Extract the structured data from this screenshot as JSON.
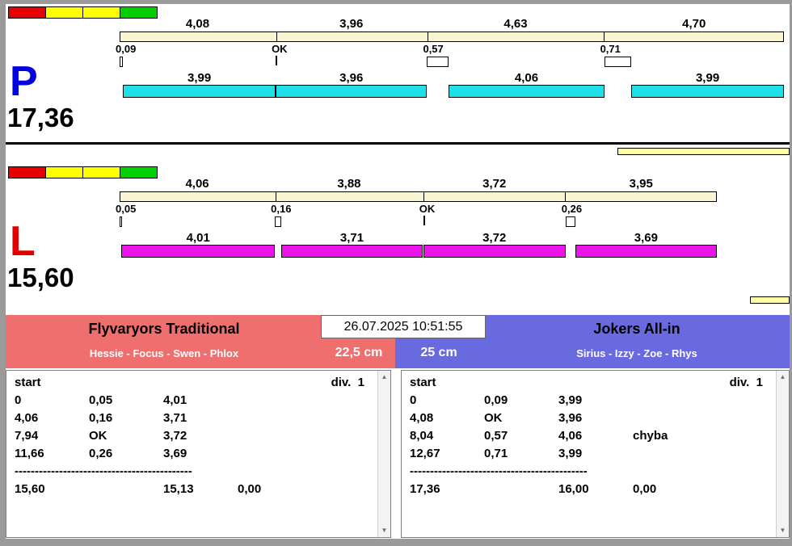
{
  "window": {
    "datetime": "26.07.2025 10:51:55",
    "frame_color": "#9a9a9a",
    "progress_color": "#ffffa8"
  },
  "lanes": [
    {
      "letter": "P",
      "letter_color": "#0000e0",
      "total_label": "17,36",
      "status_lights": [
        "#e80000",
        "#ffff00",
        "#ffff00",
        "#00cf00"
      ],
      "split_color": "#f9f5d2",
      "run_color": "#1fdfe8",
      "splits": [
        {
          "label": "4,08",
          "value": 4.08
        },
        {
          "label": "3,96",
          "value": 3.96
        },
        {
          "label": "4,63",
          "value": 4.63
        },
        {
          "label": "4,70",
          "value": 4.7
        }
      ],
      "changes": [
        {
          "label": "0,09",
          "at": 0,
          "error": 0.09
        },
        {
          "label": "OK",
          "at": 4.08,
          "error": 0
        },
        {
          "label": "0,57",
          "at": 8.04,
          "error": 0.57
        },
        {
          "label": "0,71",
          "at": 12.67,
          "error": 0.71
        }
      ],
      "runs": [
        {
          "label": "3,99",
          "start": 0.09,
          "value": 3.99
        },
        {
          "label": "3,96",
          "start": 4.08,
          "value": 3.96
        },
        {
          "label": "4,06",
          "start": 8.61,
          "value": 4.06
        },
        {
          "label": "3,99",
          "start": 13.38,
          "value": 3.99
        }
      ]
    },
    {
      "letter": "L",
      "letter_color": "#e00000",
      "total_label": "15,60",
      "status_lights": [
        "#e80000",
        "#ffff00",
        "#ffff00",
        "#00cf00"
      ],
      "split_color": "#f9f5d2",
      "run_color": "#ea14ea",
      "splits": [
        {
          "label": "4,06",
          "value": 4.06
        },
        {
          "label": "3,88",
          "value": 3.88
        },
        {
          "label": "3,72",
          "value": 3.72
        },
        {
          "label": "3,95",
          "value": 3.95
        }
      ],
      "changes": [
        {
          "label": "0,05",
          "at": 0,
          "error": 0.05
        },
        {
          "label": "0,16",
          "at": 4.06,
          "error": 0.16
        },
        {
          "label": "OK",
          "at": 7.94,
          "error": 0
        },
        {
          "label": "0,26",
          "at": 11.66,
          "error": 0.26
        }
      ],
      "runs": [
        {
          "label": "4,01",
          "start": 0.05,
          "value": 4.01
        },
        {
          "label": "3,71",
          "start": 4.22,
          "value": 3.71
        },
        {
          "label": "3,72",
          "start": 7.94,
          "value": 3.72
        },
        {
          "label": "3,69",
          "start": 11.92,
          "value": 3.69
        }
      ]
    }
  ],
  "teams": [
    {
      "name": "Flyvaryors Traditional",
      "members": "Hessie - Focus - Swen - Phlox",
      "color": "#ef6e6e",
      "height_label": "22,5 cm",
      "table": {
        "header_left": "start",
        "header_right": "div.  1",
        "rows": [
          [
            "0",
            "0,05",
            "4,01",
            ""
          ],
          [
            "4,06",
            "0,16",
            "3,71",
            ""
          ],
          [
            "7,94",
            "OK",
            "3,72",
            ""
          ],
          [
            "11,66",
            "0,26",
            "3,69",
            ""
          ]
        ],
        "divider": "--------------------------------------------",
        "totals": [
          "15,60",
          "",
          "15,13",
          "0,00"
        ]
      }
    },
    {
      "name": "Jokers All-in",
      "members": "Sirius - Izzy - Zoe - Rhys",
      "color": "#6a6ae0",
      "height_label": "25 cm",
      "table": {
        "header_left": "start",
        "header_right": "div.  1",
        "rows": [
          [
            "0",
            "0,09",
            "3,99",
            ""
          ],
          [
            "4,08",
            "OK",
            "3,96",
            ""
          ],
          [
            "8,04",
            "0,57",
            "4,06",
            "chyba"
          ],
          [
            "12,67",
            "0,71",
            "3,99",
            ""
          ]
        ],
        "divider": "--------------------------------------------",
        "totals": [
          "17,36",
          "",
          "16,00",
          "0,00"
        ]
      }
    }
  ],
  "scrollbar": {
    "up_glyph": "▲",
    "down_glyph": "▼"
  }
}
